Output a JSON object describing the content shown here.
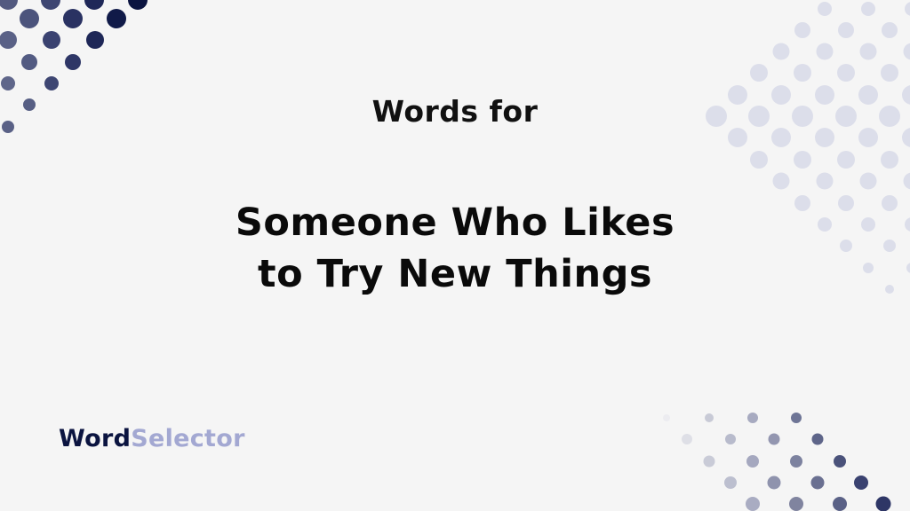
{
  "subtitle": "Words for",
  "title_line1": "Someone Who Likes",
  "title_line2": "to Try New Things",
  "logo": {
    "part1": "Word",
    "part2": "Selector",
    "color1": "#0b1440",
    "color2": "#a3a8d2"
  },
  "colors": {
    "background": "#f5f5f5",
    "dot_dark": "#0b1440",
    "dot_light": "#d9dbe8"
  }
}
